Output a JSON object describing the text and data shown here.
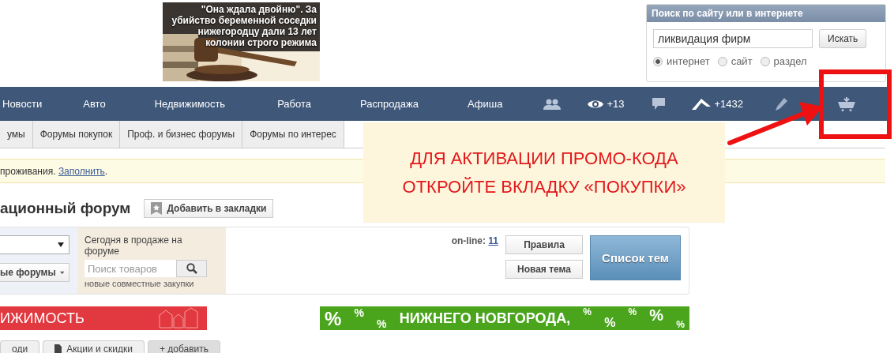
{
  "news_teaser": {
    "headline": "\"Она ждала двойню\". За убийство беременной соседки нижегородцу дали 13 лет колонии строго режима"
  },
  "site_search": {
    "title": "Поиск по сайту или в интернете",
    "value": "ликвидация фирм",
    "button": "Искать",
    "scopes": [
      {
        "label": "интернет",
        "selected": true
      },
      {
        "label": "сайт",
        "selected": false
      },
      {
        "label": "раздел",
        "selected": false
      }
    ]
  },
  "nav": {
    "links": [
      "Новости",
      "Авто",
      "Недвижимость",
      "Работа",
      "Распродажа",
      "Афиша"
    ],
    "icons": [
      {
        "kind": "people"
      },
      {
        "kind": "views",
        "count": "+13"
      },
      {
        "kind": "messages"
      },
      {
        "kind": "rating",
        "count": "+1432"
      },
      {
        "kind": "edit"
      },
      {
        "kind": "cart"
      }
    ]
  },
  "subtabs": [
    "умы",
    "Форумы покупок",
    "Проф. и бизнес форумы",
    "Форумы по интерес"
  ],
  "notice": {
    "text": "проживания.",
    "link": "Заполнить",
    "after": "."
  },
  "page_title": "ационный форум",
  "bookmark_button": "Добавить в закладки",
  "forum_panel": {
    "forums_button": "ые форумы",
    "sale_title": "Сегодня в продаже на форуме",
    "product_search_placeholder": "Поиск товаров",
    "sale_link": "новые совместные закупки",
    "online_label": "on-line:",
    "online_count": "11",
    "rules_button": "Правила",
    "new_topic_button": "Новая тема",
    "topics_button": "Список тем"
  },
  "banners": [
    {
      "kind": "realty",
      "text": "ИЖИМОСТЬ"
    },
    {
      "kind": "sale",
      "text": "НИЖНЕГО НОВГОРОДА,",
      "marks": [
        "%",
        "%",
        "%",
        "%",
        "%",
        "%",
        "%",
        "%"
      ]
    }
  ],
  "section_tabs": [
    {
      "kind": "plain",
      "label": "оди"
    },
    {
      "kind": "doc",
      "label": "Акции и скидки"
    },
    {
      "kind": "add",
      "label": "+ добавить"
    }
  ],
  "promo": {
    "lines": [
      "ДЛЯ АКТИВАЦИИ ПРОМО-КОДА",
      "ОТКРОЙТЕ ВКЛАДКУ «ПОКУПКИ»"
    ]
  }
}
